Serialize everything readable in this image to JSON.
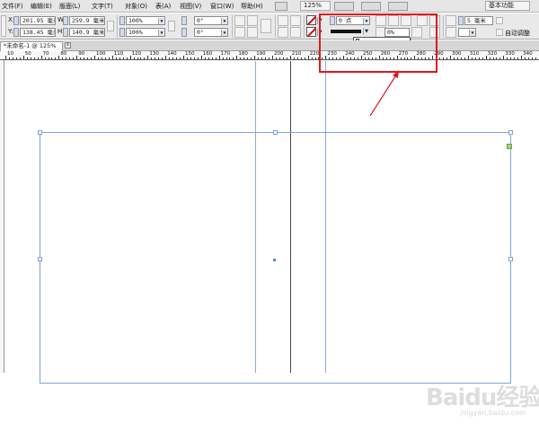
{
  "menubar": {
    "items": [
      "文件(F)",
      "编辑(E)",
      "版面(L)",
      "文字(T)",
      "对象(O)",
      "表(A)",
      "视图(V)",
      "窗口(W)",
      "帮助(H)"
    ],
    "zoom": "125%",
    "workspace": "基本功能"
  },
  "control": {
    "x_label": "X:",
    "x_value": "201.95 毫米",
    "y_label": "Y:",
    "y_value": "138.45 毫米",
    "w_label": "W:",
    "w_value": "259.9 毫米",
    "h_label": "H:",
    "h_value": "140.9 毫米",
    "scale_x": "100%",
    "scale_y": "100%",
    "rotate": "0°",
    "shear": "0°",
    "stroke_weight": "0 点",
    "tint": "0%",
    "spacing": "5 毫米",
    "auto_fit_label": "自动调整"
  },
  "document": {
    "tab_title": "*未命名-1 @ 125%",
    "close": "x"
  },
  "ruler": {
    "marks": [
      "10",
      "50",
      "70",
      "80",
      "90",
      "100",
      "110",
      "120",
      "130",
      "140",
      "150",
      "160",
      "170",
      "180",
      "190",
      "200",
      "210",
      "220",
      "230",
      "240",
      "250",
      "260",
      "270",
      "280",
      "290",
      "300",
      "310",
      "320",
      "330",
      "340"
    ]
  },
  "watermark": {
    "text": "Baidu经验",
    "url": "jingyan.baidu.com"
  },
  "colors": {
    "highlight": "#e0191c",
    "frame": "#7da4da",
    "guide": "#8aaae0"
  }
}
